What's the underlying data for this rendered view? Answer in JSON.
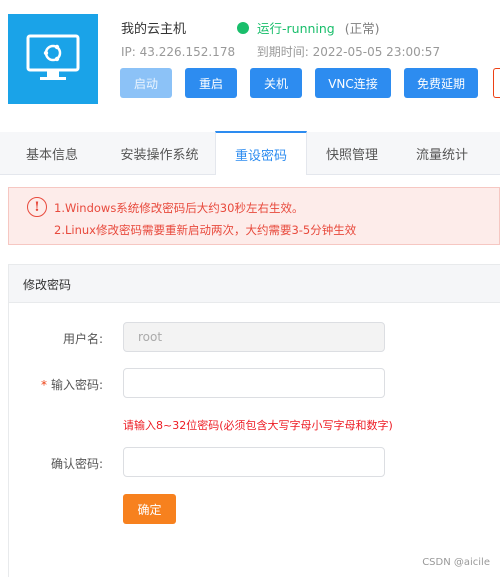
{
  "server": {
    "name": "我的云主机",
    "status": "运行-running",
    "status_note": "(正常)",
    "ip_label": "IP:",
    "ip": "43.226.152.178",
    "expiry_label": "到期时间:",
    "expiry": "2022-05-05 23:00:57",
    "status_color": "#19be6b",
    "icon": "monitor-icon"
  },
  "actions": {
    "start": "启动",
    "restart": "重启",
    "shutdown": "关机",
    "vnc": "VNC连接",
    "renew": "免费延期"
  },
  "tabs": [
    "基本信息",
    "安装操作系统",
    "重设密码",
    "快照管理",
    "流量统计"
  ],
  "active_tab": "重设密码",
  "alert": {
    "icon": "!",
    "line1": "1.Windows系统修改密码后大约30秒左右生效。",
    "line2": "2.Linux修改密码需要重新启动两次，大约需要3-5分钟生效"
  },
  "form": {
    "title": "修改密码",
    "username_label": "用户名:",
    "username_value": "root",
    "password_label": "输入密码:",
    "required_mark": "*",
    "password_value": "",
    "confirm_label": "确认密码:",
    "confirm_value": "",
    "hint": "请输入8~32位密码(必须包含大写字母小写字母和数字)",
    "submit": "确定"
  },
  "watermark": "CSDN @aicile",
  "colors": {
    "primary": "#2d8cf0",
    "danger": "#ed4014",
    "submit": "#f7811e",
    "icon_bg": "#1aa3e8"
  }
}
